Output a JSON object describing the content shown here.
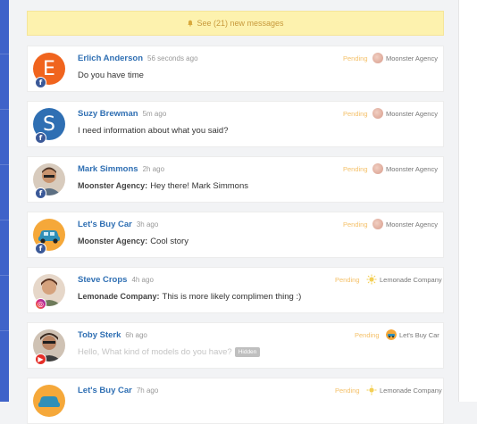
{
  "banner": {
    "text": "See (21) new messages",
    "icon": "bell-icon"
  },
  "colors": {
    "accent_rail": "#3f63c9",
    "name_link": "#2f6fb3",
    "pending": "#f4c068",
    "banner_bg": "#fdf2ae"
  },
  "messages": [
    {
      "avatar_letter": "E",
      "avatar_color": "#f0641e",
      "source": "facebook",
      "name": "Erlich Anderson",
      "time": "56 seconds ago",
      "agent": "",
      "text": "Do you have time",
      "status": "Pending",
      "channel": "Moonster Agency"
    },
    {
      "avatar_letter": "S",
      "avatar_color": "#2f6fb3",
      "source": "facebook",
      "name": "Suzy Brewman",
      "time": "5m ago",
      "agent": "",
      "text": "I need information about what you said?",
      "status": "Pending",
      "channel": "Moonster Agency"
    },
    {
      "avatar_letter": "",
      "avatar_color": "#7a5a44",
      "source": "facebook",
      "name": "Mark Simmons",
      "time": "2h ago",
      "agent": "Moonster Agency:",
      "text": "Hey there! Mark Simmons",
      "status": "Pending",
      "channel": "Moonster Agency"
    },
    {
      "avatar_letter": "",
      "avatar_color": "#f5a83a",
      "source": "facebook",
      "name": "Let's Buy Car",
      "time": "3h ago",
      "agent": "Moonster Agency:",
      "text": "Cool story",
      "status": "Pending",
      "channel": "Moonster Agency"
    },
    {
      "avatar_letter": "",
      "avatar_color": "#8a5a48",
      "source": "instagram",
      "name": "Steve Crops",
      "time": "4h ago",
      "agent": "Lemonade Company:",
      "text": "This is more likely complimen thing :)",
      "status": "Pending",
      "channel": "Lemonade Company"
    },
    {
      "avatar_letter": "",
      "avatar_color": "#5a4032",
      "source": "youtube",
      "name": "Toby Sterk",
      "time": "6h ago",
      "agent": "",
      "text": "Hello, What kind of models do you have?",
      "hidden_label": "Hidden",
      "status": "Pending",
      "channel": "Let's Buy Car"
    },
    {
      "avatar_letter": "",
      "avatar_color": "#f5a83a",
      "source": "facebook",
      "name": "Let's Buy Car",
      "time": "7h ago",
      "agent": "",
      "text": "",
      "status": "Pending",
      "channel": "Lemonade Company"
    }
  ]
}
